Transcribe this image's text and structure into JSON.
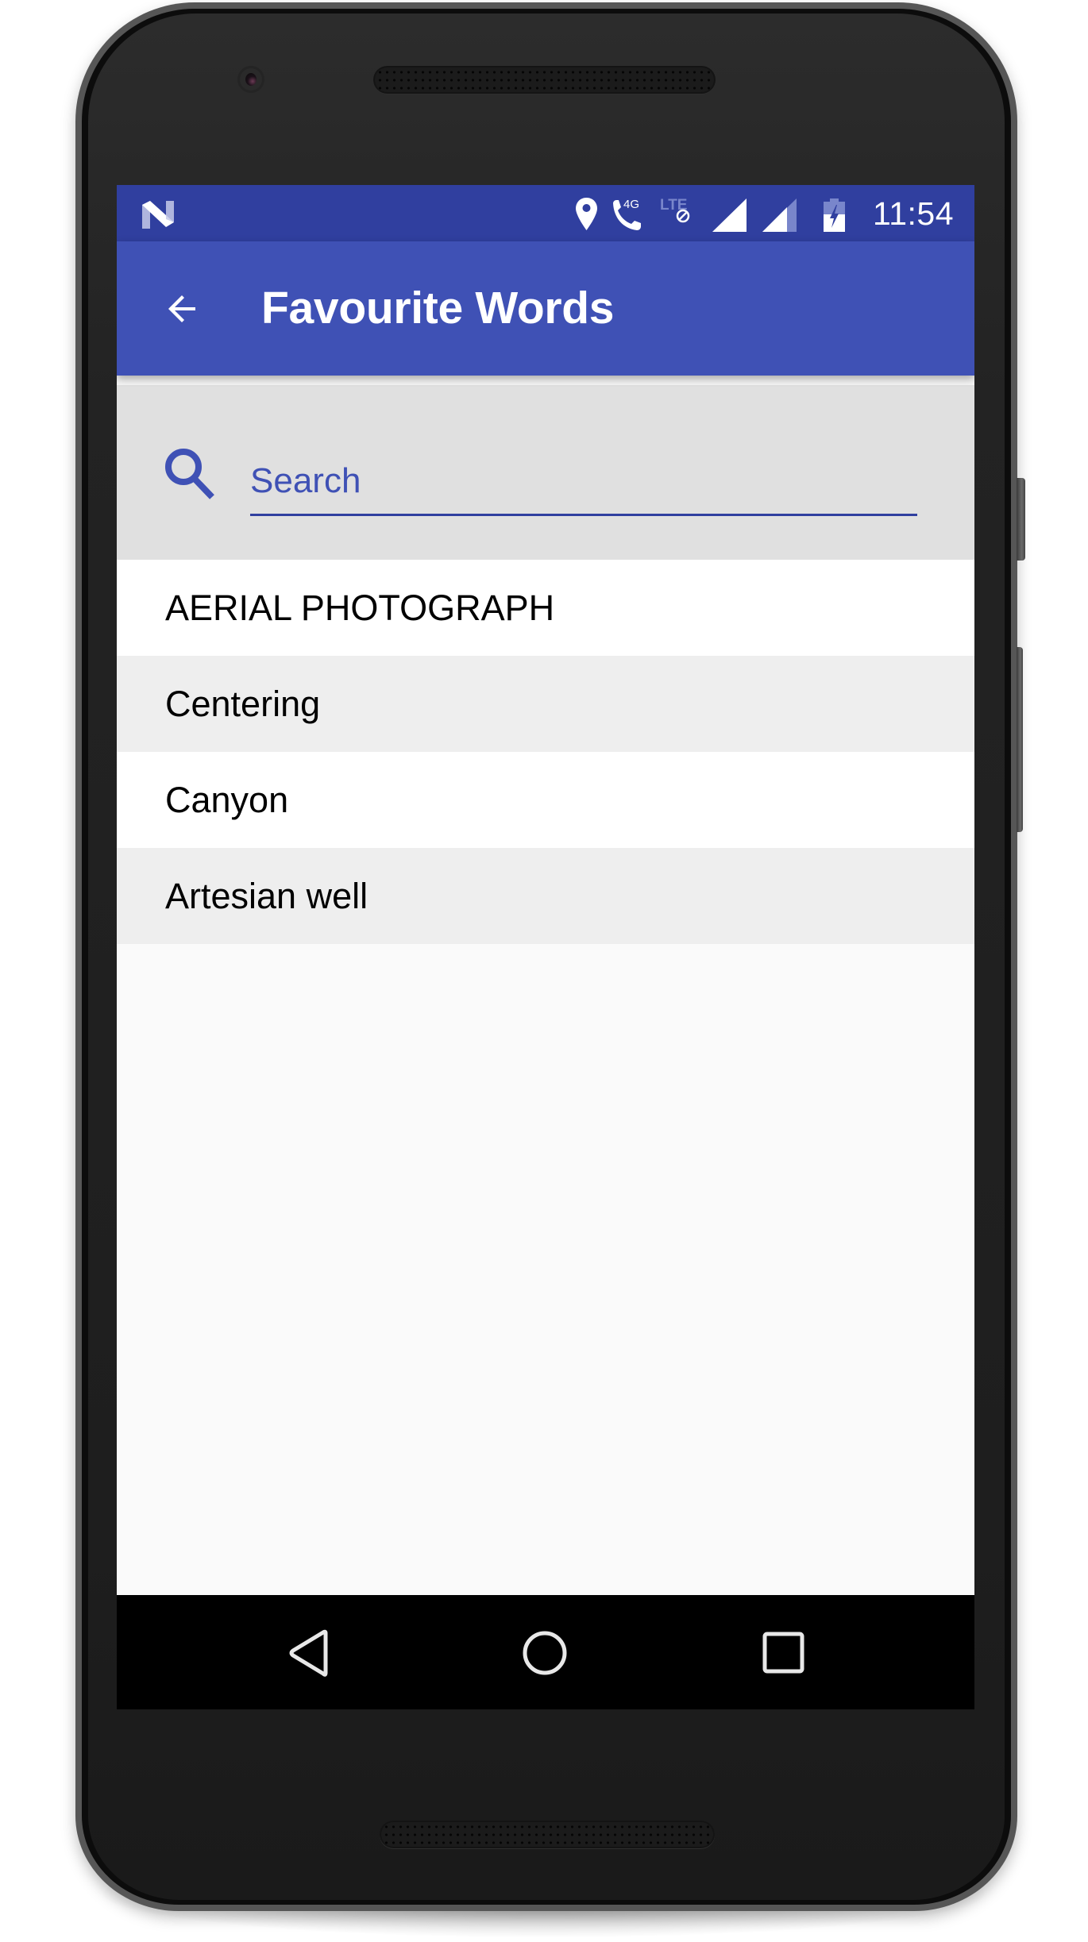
{
  "status_bar": {
    "notification_icon": "android-n-logo-icon",
    "icons": [
      "location-pin-icon",
      "wifi-calling-4g-icon",
      "lte-disabled-icon",
      "signal-full-icon",
      "signal-partial-icon",
      "battery-charging-icon"
    ],
    "network_label": "4G",
    "lte_label": "LTE",
    "time": "11:54"
  },
  "app_bar": {
    "back_icon": "arrow-back-icon",
    "title": "Favourite Words"
  },
  "search": {
    "icon": "search-icon",
    "placeholder": "Search",
    "value": ""
  },
  "words": [
    {
      "label": "AERIAL PHOTOGRAPH"
    },
    {
      "label": "Centering"
    },
    {
      "label": "Canyon"
    },
    {
      "label": "Artesian well"
    }
  ],
  "nav_bar": {
    "back_icon": "nav-back-icon",
    "home_icon": "nav-home-icon",
    "recents_icon": "nav-recents-icon"
  },
  "colors": {
    "primary": "#3F51B5",
    "primary_dark": "#303F9F",
    "search_background": "#E0E0E0",
    "row_alt": "#EEEEEE",
    "screen_background": "#FAFAFA"
  }
}
